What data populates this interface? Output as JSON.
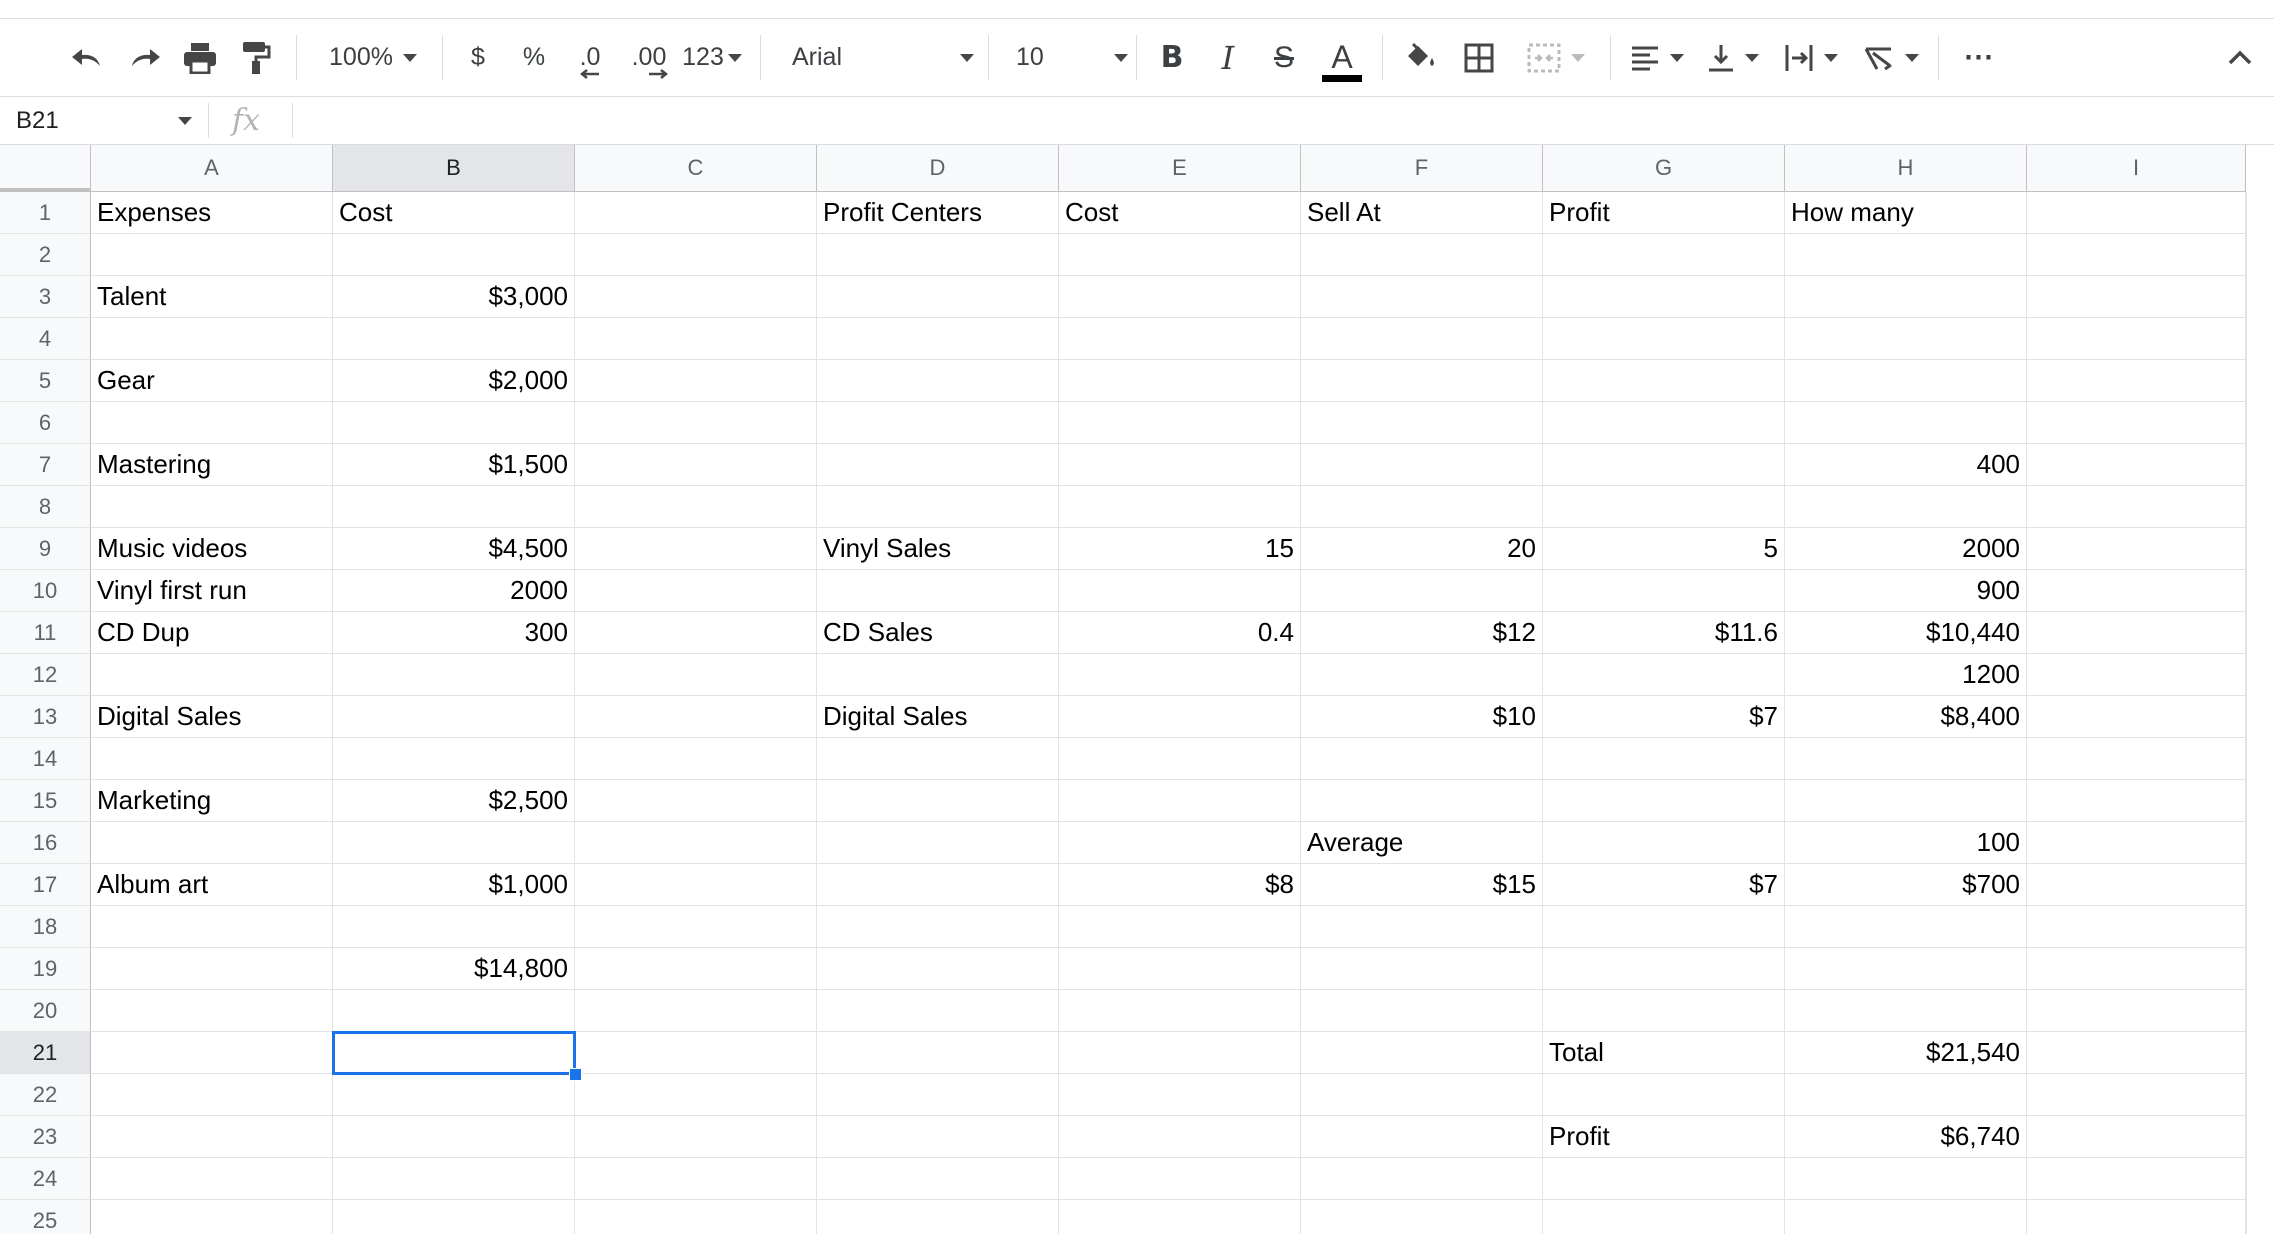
{
  "toolbar": {
    "zoom": "100%",
    "currency_label": "$",
    "percent_label": "%",
    "decrease_decimal_label": ".0",
    "increase_decimal_label": ".00",
    "more_formats_label": "123",
    "font": "Arial",
    "font_size": "10",
    "bold_label": "B",
    "italic_label": "I",
    "strike_label": "S",
    "text_color_label": "A",
    "text_color": "#000000",
    "more_label": "⋯"
  },
  "formula_bar": {
    "name_box": "B21",
    "fx_label": "fx",
    "value": ""
  },
  "sheet": {
    "active_cell": "B21",
    "accent_color": "#1a73e8",
    "columns": [
      "A",
      "B",
      "C",
      "D",
      "E",
      "F",
      "G",
      "H",
      "I"
    ],
    "rows": [
      "1",
      "2",
      "3",
      "4",
      "5",
      "6",
      "7",
      "8",
      "9",
      "10",
      "11",
      "12",
      "13",
      "14",
      "15",
      "16",
      "17",
      "18",
      "19",
      "20",
      "21",
      "22",
      "23",
      "24",
      "25"
    ],
    "cells": {
      "A1": "Expenses",
      "B1": "Cost",
      "D1": "Profit Centers",
      "E1": "Cost",
      "F1": "Sell At",
      "G1": "Profit",
      "H1": "How many",
      "A3": "Talent",
      "B3": "$3,000",
      "A5": "Gear",
      "B5": "$2,000",
      "A7": "Mastering",
      "B7": "$1,500",
      "H7": "400",
      "A9": "Music videos",
      "B9": "$4,500",
      "D9": "Vinyl Sales",
      "E9": "15",
      "F9": "20",
      "G9": "5",
      "H9": "2000",
      "A10": "Vinyl first run",
      "B10": "2000",
      "H10": "900",
      "A11": "CD Dup",
      "B11": "300",
      "D11": "CD Sales",
      "E11": "0.4",
      "F11": "$12",
      "G11": "$11.6",
      "H11": "$10,440",
      "H12": "1200",
      "A13": "Digital Sales",
      "D13": "Digital Sales",
      "F13": "$10",
      "G13": "$7",
      "H13": "$8,400",
      "A15": "Marketing",
      "B15": "$2,500",
      "F16": "Average",
      "H16": "100",
      "A17": "Album art",
      "B17": "$1,000",
      "E17": "$8",
      "F17": "$15",
      "G17": "$7",
      "H17": "$700",
      "B19": "$14,800",
      "G21": "Total",
      "H21": "$21,540",
      "G23": "Profit",
      "H23": "$6,740"
    }
  }
}
